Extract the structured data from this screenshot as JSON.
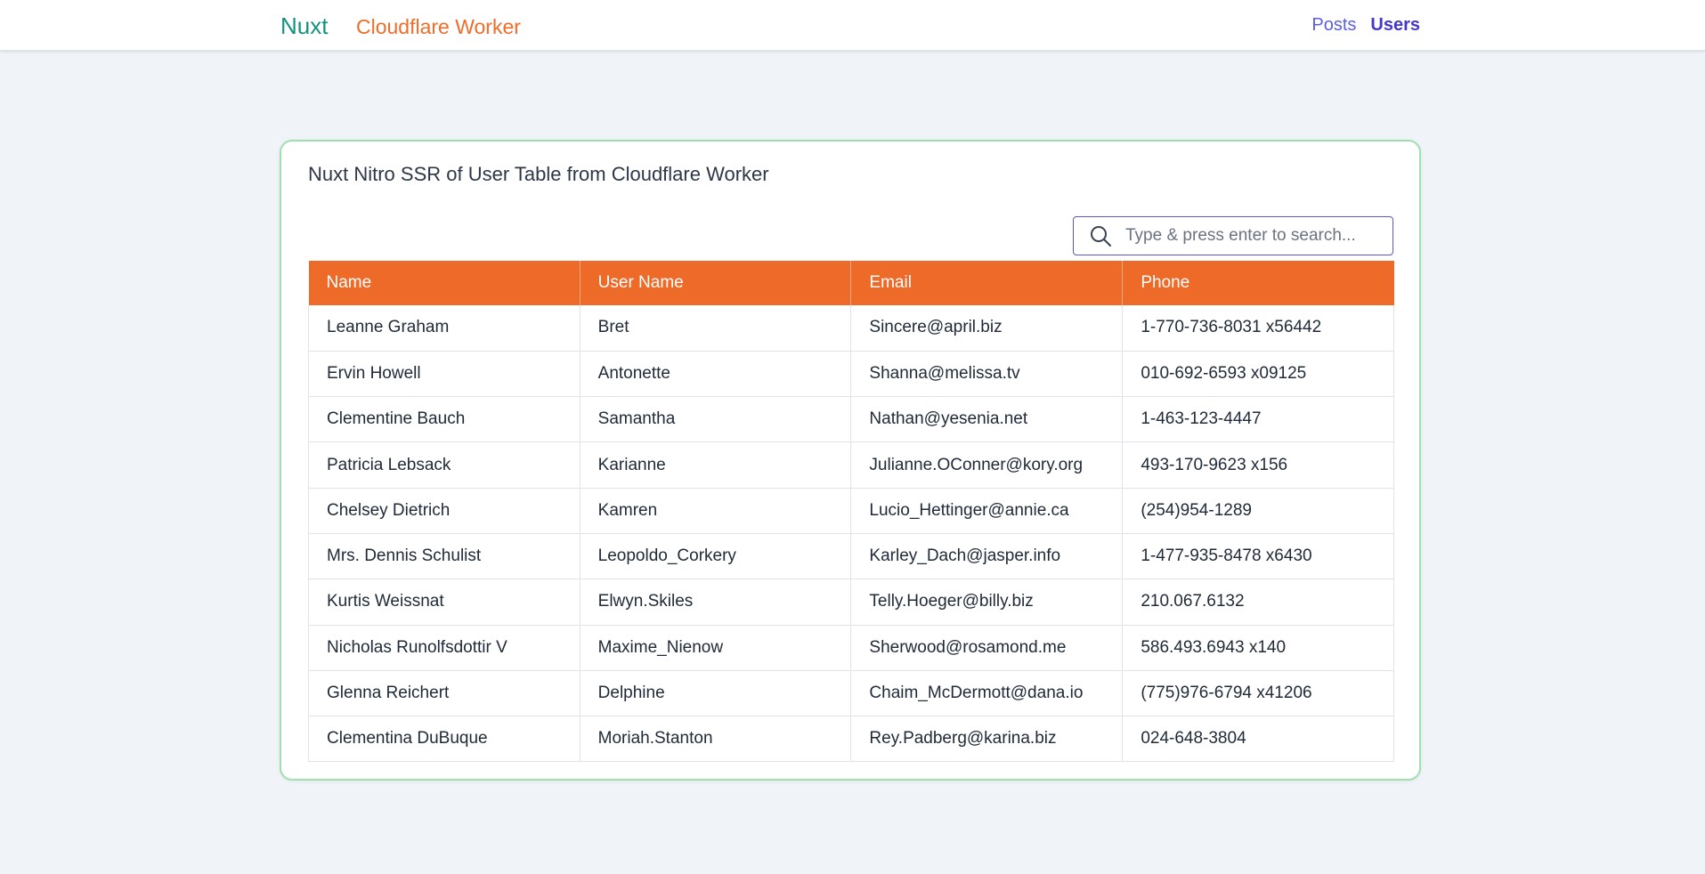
{
  "header": {
    "brand_nuxt": "Nuxt",
    "brand_cloudflare": "Cloudflare Worker",
    "nav": [
      {
        "label": "Posts",
        "active": false
      },
      {
        "label": "Users",
        "active": true
      }
    ]
  },
  "card": {
    "title": "Nuxt Nitro SSR of User Table from Cloudflare Worker",
    "search": {
      "placeholder": "Type & press enter to search...",
      "value": "",
      "icon": "search-icon"
    }
  },
  "table": {
    "headers": [
      "Name",
      "User Name",
      "Email",
      "Phone"
    ],
    "rows": [
      [
        "Leanne Graham",
        "Bret",
        "Sincere@april.biz",
        "1-770-736-8031 x56442"
      ],
      [
        "Ervin Howell",
        "Antonette",
        "Shanna@melissa.tv",
        "010-692-6593 x09125"
      ],
      [
        "Clementine Bauch",
        "Samantha",
        "Nathan@yesenia.net",
        "1-463-123-4447"
      ],
      [
        "Patricia Lebsack",
        "Karianne",
        "Julianne.OConner@kory.org",
        "493-170-9623 x156"
      ],
      [
        "Chelsey Dietrich",
        "Kamren",
        "Lucio_Hettinger@annie.ca",
        "(254)954-1289"
      ],
      [
        "Mrs. Dennis Schulist",
        "Leopoldo_Corkery",
        "Karley_Dach@jasper.info",
        "1-477-935-8478 x6430"
      ],
      [
        "Kurtis Weissnat",
        "Elwyn.Skiles",
        "Telly.Hoeger@billy.biz",
        "210.067.6132"
      ],
      [
        "Nicholas Runolfsdottir V",
        "Maxime_Nienow",
        "Sherwood@rosamond.me",
        "586.493.6943 x140"
      ],
      [
        "Glenna Reichert",
        "Delphine",
        "Chaim_McDermott@dana.io",
        "(775)976-6794 x41206"
      ],
      [
        "Clementina DuBuque",
        "Moriah.Stanton",
        "Rey.Padberg@karina.biz",
        "024-648-3804"
      ]
    ]
  },
  "colors": {
    "nuxt_green": "#16917f",
    "cloudflare_orange": "#ef6d2a",
    "header_orange": "#ed6a28",
    "nav_purple": "#4338ca",
    "card_border": "#9ee0b0",
    "background": "#f0f3f7"
  }
}
